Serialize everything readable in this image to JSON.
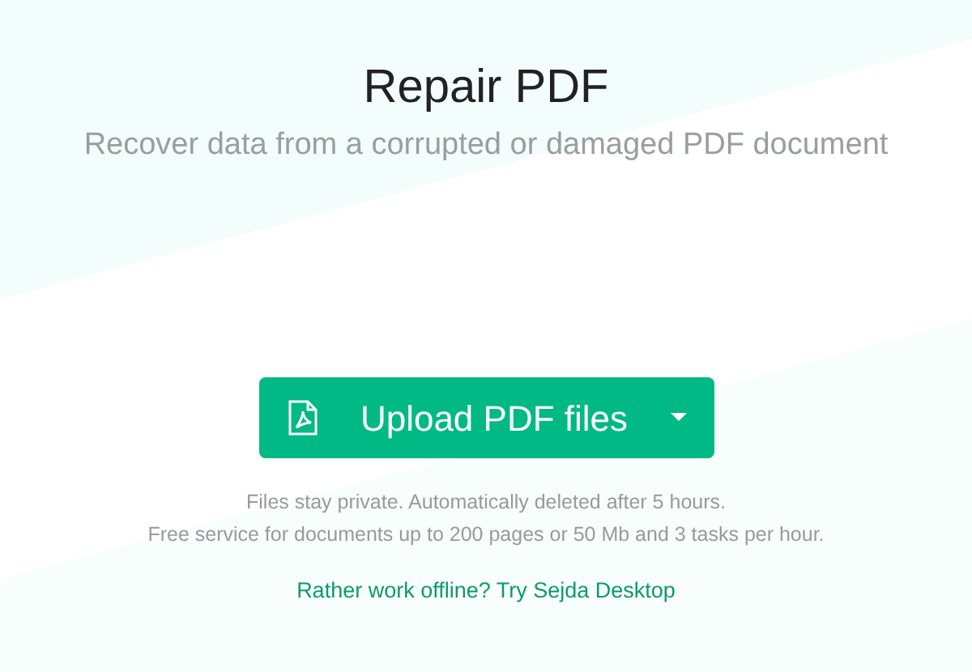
{
  "title": "Repair PDF",
  "subtitle": "Recover data from a corrupted or damaged PDF document",
  "upload_button": {
    "label": "Upload PDF files"
  },
  "notes": [
    "Files stay private. Automatically deleted after 5 hours.",
    "Free service for documents up to 200 pages or 50 Mb and 3 tasks per hour."
  ],
  "offline_link": "Rather work offline? Try Sejda Desktop"
}
